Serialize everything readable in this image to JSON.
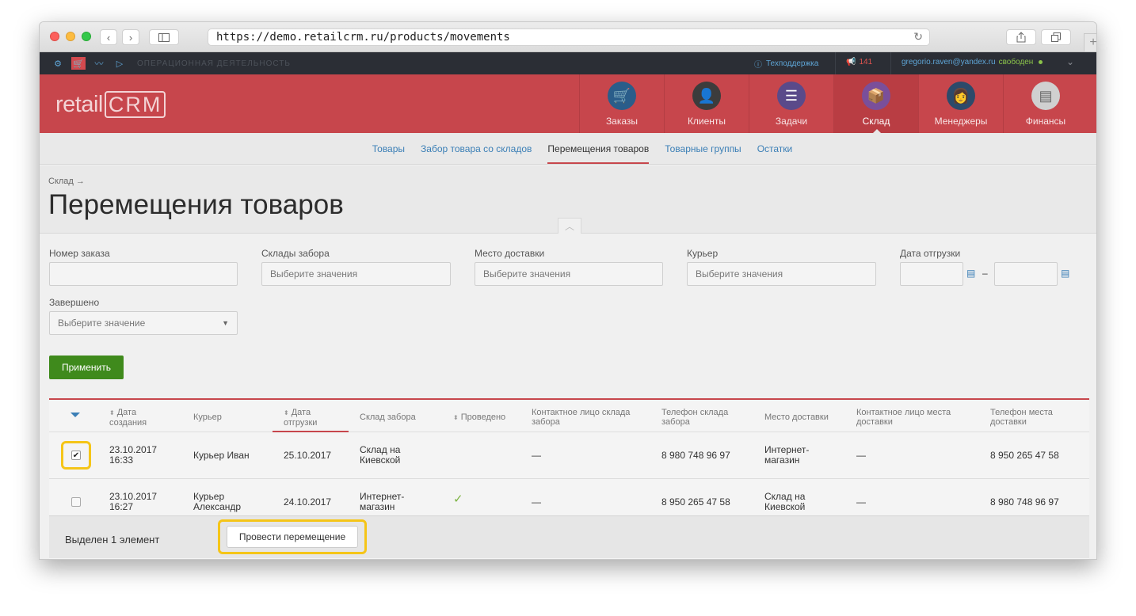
{
  "browser": {
    "url": "https://demo.retailcrm.ru/products/movements"
  },
  "topbar": {
    "section": "ОПЕРАЦИОННАЯ ДЕЯТЕЛЬНОСТЬ",
    "support": "Техподдержка",
    "notifications": "141",
    "user_email": "gregorio.raven@yandex.ru",
    "user_status": "свободен"
  },
  "header": {
    "logo_text": "retail",
    "logo_crm": "CRM",
    "nav": [
      {
        "label": "Заказы",
        "icon": "cart-icon",
        "color": "#2a5d8a"
      },
      {
        "label": "Клиенты",
        "icon": "client-icon",
        "color": "#3c3c3c"
      },
      {
        "label": "Задачи",
        "icon": "tasks-icon",
        "color": "#5a4a8a"
      },
      {
        "label": "Склад",
        "icon": "warehouse-icon",
        "color": "#7a4f9a"
      },
      {
        "label": "Менеджеры",
        "icon": "manager-icon",
        "color": "#2d4a6a"
      },
      {
        "label": "Финансы",
        "icon": "finance-icon",
        "color": "#d0d0d0"
      }
    ]
  },
  "subnav": {
    "items": [
      "Товары",
      "Забор товара со складов",
      "Перемещения товаров",
      "Товарные группы",
      "Остатки"
    ],
    "active_index": 2
  },
  "page": {
    "breadcrumb": "Склад →",
    "title": "Перемещения товаров"
  },
  "filters": {
    "order_number": "Номер заказа",
    "pickup_warehouses": "Склады забора",
    "pickup_placeholder": "Выберите значения",
    "delivery_place": "Место доставки",
    "delivery_placeholder": "Выберите значения",
    "courier": "Курьер",
    "courier_placeholder": "Выберите значения",
    "ship_date": "Дата отгрузки",
    "date_dash": "–",
    "completed": "Завершено",
    "completed_placeholder": "Выберите значение",
    "apply": "Применить"
  },
  "table": {
    "headers": {
      "created": "Дата создания",
      "courier": "Курьер",
      "ship_date": "Дата отгрузки",
      "pickup_warehouse": "Склад забора",
      "done": "Проведено",
      "pickup_contact": "Контактное лицо склада забора",
      "pickup_phone": "Телефон склада забора",
      "delivery_place": "Место доставки",
      "delivery_contact": "Контактное лицо места доставки",
      "delivery_phone": "Телефон места доставки"
    },
    "rows": [
      {
        "created_date": "23.10.2017",
        "created_time": "16:33",
        "courier": "Курьер Иван",
        "ship_date": "25.10.2017",
        "pickup_warehouse": "Склад на Киевской",
        "pickup_contact": "—",
        "pickup_phone": "8 980 748 96 97",
        "delivery_place": "Интернет-магазин",
        "delivery_contact": "—",
        "delivery_phone": "8 950 265 47 58",
        "checked": true,
        "done": false
      },
      {
        "created_date": "23.10.2017",
        "created_time": "16:27",
        "courier": "Курьер Александр",
        "ship_date": "24.10.2017",
        "pickup_warehouse": "Интернет-магазин",
        "pickup_contact": "—",
        "pickup_phone": "8 950 265 47 58",
        "delivery_place": "Склад на Киевской",
        "delivery_contact": "—",
        "delivery_phone": "8 980 748 96 97",
        "checked": false,
        "done": true
      }
    ]
  },
  "actionbar": {
    "selected_text": "Выделен 1 элемент",
    "action_button": "Провести перемещение"
  }
}
